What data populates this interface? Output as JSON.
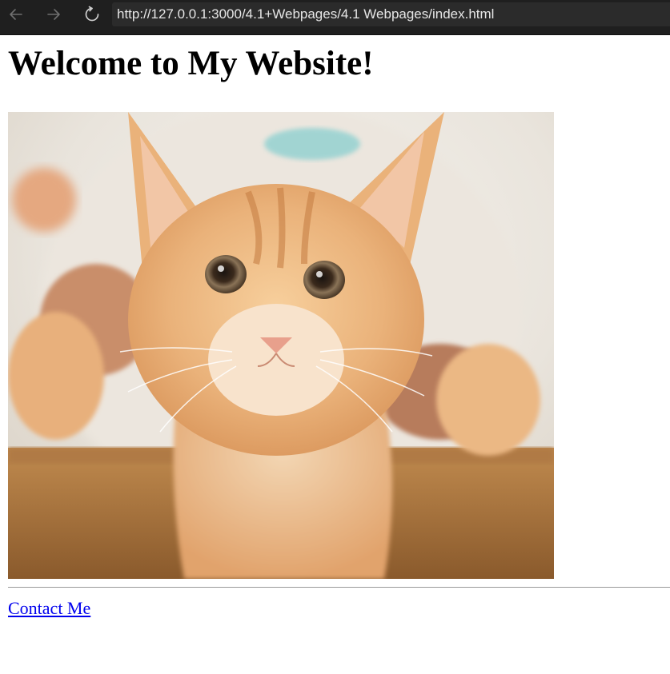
{
  "browser": {
    "url": "http://127.0.0.1:3000/4.1+Webpages/4.1 Webpages/index.html",
    "back_icon": "arrow-left-icon",
    "forward_icon": "arrow-right-icon",
    "reload_icon": "reload-icon"
  },
  "page": {
    "heading": "Welcome to My Website!",
    "image_subject": "kitten-photo",
    "link_text": "Contact Me",
    "link_color": "#0000ee"
  }
}
